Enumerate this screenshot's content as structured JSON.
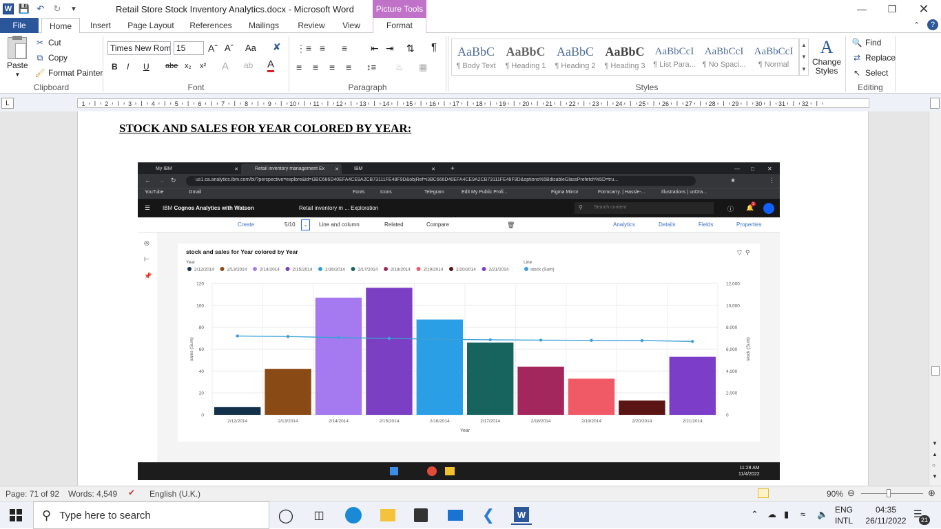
{
  "window": {
    "doc_title": "Retail Store Stock Inventory Analytics.docx  -  Microsoft Word",
    "picture_tools": "Picture Tools"
  },
  "tabs": [
    "File",
    "Home",
    "Insert",
    "Page Layout",
    "References",
    "Mailings",
    "Review",
    "View",
    "Format"
  ],
  "ribbon": {
    "clipboard": {
      "paste": "Paste",
      "cut": "Cut",
      "copy": "Copy",
      "format_painter": "Format Painter",
      "label": "Clipboard"
    },
    "font": {
      "name": "Times New Rom",
      "size": "15",
      "label": "Font"
    },
    "paragraph": {
      "label": "Paragraph"
    },
    "styles": {
      "items": [
        {
          "sample": "AaBbC",
          "name": "¶ Body Text"
        },
        {
          "sample": "AaBbC",
          "name": "¶ Heading 1"
        },
        {
          "sample": "AaBbC",
          "name": "¶ Heading 2"
        },
        {
          "sample": "AaBbC",
          "name": "¶ Heading 3"
        },
        {
          "sample": "AaBbCcI",
          "name": "¶ List Para..."
        },
        {
          "sample": "AaBbCcI",
          "name": "¶ No Spaci..."
        },
        {
          "sample": "AaBbCcI",
          "name": "¶ Normal"
        }
      ],
      "change_styles": "Change Styles",
      "label": "Styles"
    },
    "editing": {
      "find": "Find",
      "replace": "Replace",
      "select": "Select",
      "label": "Editing"
    }
  },
  "ruler_numbers": [
    "1",
    "2",
    "3",
    "4",
    "5",
    "6",
    "7",
    "8",
    "9",
    "10",
    "11",
    "12",
    "13",
    "14",
    "15",
    "16",
    "17",
    "18",
    "19",
    "20",
    "21",
    "22",
    "23",
    "24",
    "25",
    "26",
    "27",
    "28",
    "29",
    "30",
    "31",
    "32"
  ],
  "document": {
    "heading": "STOCK AND SALES FOR YEAR COLORED BY YEAR:"
  },
  "browser": {
    "tabs": [
      "My IBM",
      "Retail inventory management Ex",
      "IBM"
    ],
    "url": "us1.ca.analytics.ibm.com/bi/?perspective=explore&id=i3BC666D40EFA4CE9A2CB73111FE48F9D&objRef=i3BC666D40EFA4CE9A2CB73111FE48F9D&options%5BdisableGlassPrefetch%5D=tru...",
    "bookmarks": [
      "YouTube",
      "Gmail",
      "Fonts",
      "Icons",
      "Telegram",
      "Edit My Public Profi...",
      "Figma Mirror",
      "Formcarry. | Hassle-...",
      "Illustrations | unDra..."
    ]
  },
  "cognos": {
    "brand_prefix": "IBM ",
    "brand_bold": "Cognos Analytics with Watson",
    "breadcrumb": "Retail inventory m ... Exploration",
    "search_placeholder": "Search content",
    "notif_count": "3",
    "toolbar": {
      "create": "Create",
      "page": "5/10",
      "viz": "Line and column",
      "related": "Related",
      "compare": "Compare",
      "analytics": "Analytics",
      "details": "Details",
      "fields": "Fields",
      "properties": "Properties"
    }
  },
  "chart_data": {
    "type": "bar",
    "title": "stock and sales for Year colored by Year",
    "legend_title": "Year",
    "line_legend_title": "Line",
    "categories": [
      "2/12/2014",
      "2/13/2014",
      "2/14/2014",
      "2/15/2014",
      "2/16/2014",
      "2/17/2014",
      "2/18/2014",
      "2/19/2014",
      "2/20/2014",
      "2/21/2014"
    ],
    "series": [
      {
        "name": "sales (Sum)",
        "type": "bar",
        "axis": "left",
        "values": [
          7,
          42,
          107,
          116,
          87,
          66,
          44,
          33,
          13,
          53
        ]
      },
      {
        "name": "stock (Sum)",
        "type": "line",
        "axis": "right",
        "values": [
          7200,
          7150,
          7050,
          6980,
          6900,
          6850,
          6820,
          6800,
          6780,
          6700
        ]
      }
    ],
    "bar_colors": [
      "#12304a",
      "#8a4a15",
      "#a579f0",
      "#7b3fc4",
      "#2a9fe6",
      "#17645f",
      "#a3265c",
      "#f05a66",
      "#5a1414",
      "#7c3ec9"
    ],
    "line_color": "#3aa0d6",
    "xlabel": "Year",
    "ylabel": "sales (Sum)",
    "y2label": "stock (Sum)",
    "ylim": [
      0,
      120
    ],
    "y2lim": [
      0,
      12000
    ],
    "yticks": [
      "0",
      "20",
      "40",
      "60",
      "80",
      "100",
      "120"
    ],
    "y2ticks": [
      "0",
      "2,000",
      "4,000",
      "6,000",
      "8,000",
      "10,000",
      "12,000"
    ],
    "grid": true,
    "legend_placement": "top-left"
  },
  "inner_taskbar": {
    "time": "11:28 AM",
    "date": "11/4/2022"
  },
  "statusbar": {
    "page": "Page: 71 of 92",
    "words": "Words: 4,549",
    "lang": "English (U.K.)",
    "zoom": "90%"
  },
  "taskbar": {
    "search_placeholder": "Type here to search",
    "lang1": "ENG",
    "lang2": "INTL",
    "time": "04:35",
    "date": "26/11/2022",
    "notif": "21"
  }
}
